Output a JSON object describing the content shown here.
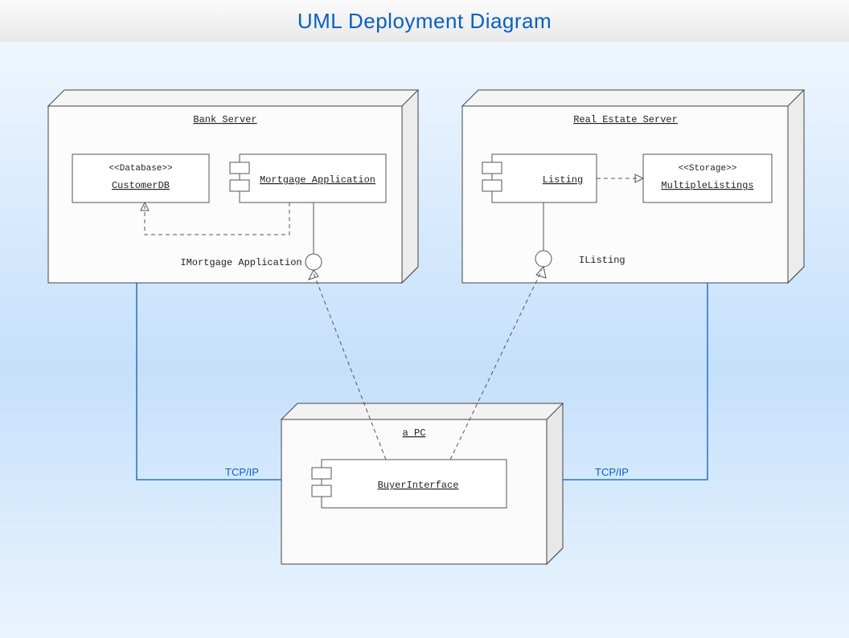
{
  "title": "UML Deployment Diagram",
  "nodes": {
    "bank": {
      "name": "Bank Server",
      "db": {
        "stereotype": "<<Database>>",
        "name": "CustomerDB"
      },
      "component": "Mortgage Application",
      "interface": "IMortgage Application"
    },
    "realestate": {
      "name": "Real Estate Server",
      "component": "Listing",
      "storage": {
        "stereotype": "<<Storage>>",
        "name": "MultipleListings"
      },
      "interface": "IListing"
    },
    "pc": {
      "name": "a PC",
      "component": "BuyerInterface"
    }
  },
  "connections": {
    "left": "TCP/IP",
    "right": "TCP/IP"
  }
}
